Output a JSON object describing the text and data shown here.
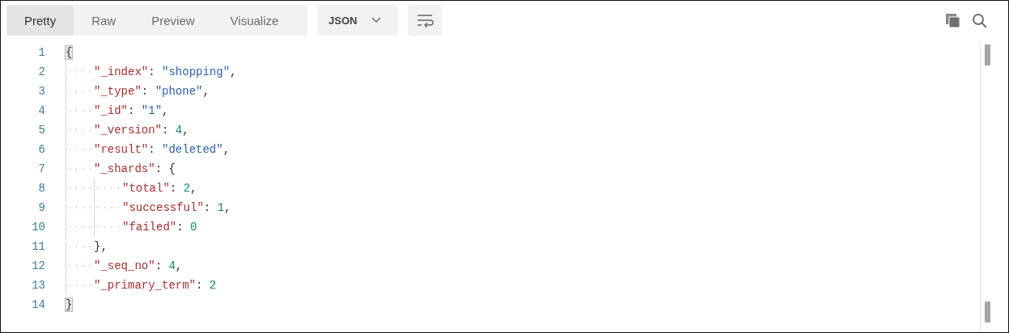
{
  "view_tabs": [
    {
      "label": "Pretty",
      "selected": true
    },
    {
      "label": "Raw",
      "selected": false
    },
    {
      "label": "Preview",
      "selected": false
    },
    {
      "label": "Visualize",
      "selected": false
    }
  ],
  "format_dropdown": {
    "value": "JSON"
  },
  "code": [
    {
      "number": "1",
      "tokens": [
        {
          "kind": "punct",
          "text": "{",
          "matched": true
        }
      ],
      "children": [
        {
          "number": "2",
          "tokens": [
            {
              "kind": "key",
              "text": "\"_index\""
            },
            {
              "kind": "punct",
              "text": ": "
            },
            {
              "kind": "string",
              "text": "\"shopping\""
            },
            {
              "kind": "punct",
              "text": ","
            }
          ]
        },
        {
          "number": "3",
          "tokens": [
            {
              "kind": "key",
              "text": "\"_type\""
            },
            {
              "kind": "punct",
              "text": ": "
            },
            {
              "kind": "string",
              "text": "\"phone\""
            },
            {
              "kind": "punct",
              "text": ","
            }
          ]
        },
        {
          "number": "4",
          "tokens": [
            {
              "kind": "key",
              "text": "\"_id\""
            },
            {
              "kind": "punct",
              "text": ": "
            },
            {
              "kind": "string",
              "text": "\"1\""
            },
            {
              "kind": "punct",
              "text": ","
            }
          ]
        },
        {
          "number": "5",
          "tokens": [
            {
              "kind": "key",
              "text": "\"_version\""
            },
            {
              "kind": "punct",
              "text": ": "
            },
            {
              "kind": "number",
              "text": "4"
            },
            {
              "kind": "punct",
              "text": ","
            }
          ]
        },
        {
          "number": "6",
          "tokens": [
            {
              "kind": "key",
              "text": "\"result\""
            },
            {
              "kind": "punct",
              "text": ": "
            },
            {
              "kind": "string",
              "text": "\"deleted\""
            },
            {
              "kind": "punct",
              "text": ","
            }
          ]
        },
        {
          "number": "7",
          "tokens": [
            {
              "kind": "key",
              "text": "\"_shards\""
            },
            {
              "kind": "punct",
              "text": ": {"
            }
          ],
          "children": [
            {
              "number": "8",
              "tokens": [
                {
                  "kind": "key",
                  "text": "\"total\""
                },
                {
                  "kind": "punct",
                  "text": ": "
                },
                {
                  "kind": "number",
                  "text": "2"
                },
                {
                  "kind": "punct",
                  "text": ","
                }
              ]
            },
            {
              "number": "9",
              "tokens": [
                {
                  "kind": "key",
                  "text": "\"successful\""
                },
                {
                  "kind": "punct",
                  "text": ": "
                },
                {
                  "kind": "number",
                  "text": "1"
                },
                {
                  "kind": "punct",
                  "text": ","
                }
              ]
            },
            {
              "number": "10",
              "tokens": [
                {
                  "kind": "key",
                  "text": "\"failed\""
                },
                {
                  "kind": "punct",
                  "text": ": "
                },
                {
                  "kind": "number",
                  "text": "0"
                }
              ]
            }
          ]
        },
        {
          "number": "11",
          "tokens": [
            {
              "kind": "punct",
              "text": "},"
            }
          ]
        },
        {
          "number": "12",
          "tokens": [
            {
              "kind": "key",
              "text": "\"_seq_no\""
            },
            {
              "kind": "punct",
              "text": ": "
            },
            {
              "kind": "number",
              "text": "4"
            },
            {
              "kind": "punct",
              "text": ","
            }
          ]
        },
        {
          "number": "13",
          "tokens": [
            {
              "kind": "key",
              "text": "\"_primary_term\""
            },
            {
              "kind": "punct",
              "text": ": "
            },
            {
              "kind": "number",
              "text": "2"
            }
          ]
        }
      ]
    },
    {
      "number": "14",
      "tokens": [
        {
          "kind": "punct",
          "text": "}",
          "matched": true
        }
      ]
    }
  ]
}
